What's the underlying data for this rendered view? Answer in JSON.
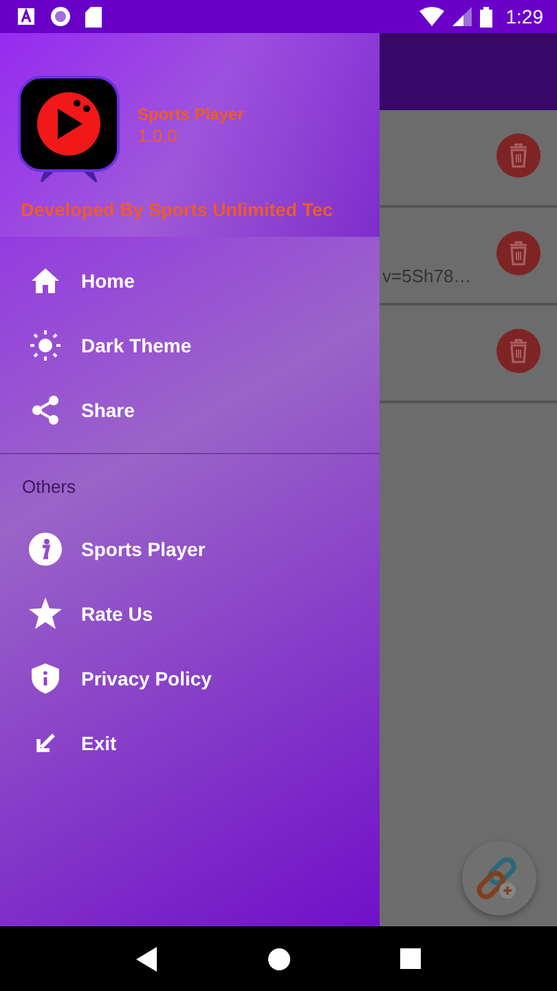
{
  "status_bar": {
    "time": "1:29"
  },
  "background": {
    "rows": [
      {
        "kind": "blank"
      },
      {
        "kind": "text",
        "text": "v=5Sh78…"
      },
      {
        "kind": "blank"
      }
    ]
  },
  "drawer": {
    "header": {
      "title": "Sports Player",
      "version": "1.0.0",
      "developer": "Developed By Sports Unlimited Tec"
    },
    "sections": [
      {
        "items": [
          {
            "kind": "home",
            "label": "Home"
          },
          {
            "kind": "sun",
            "label": "Dark Theme"
          },
          {
            "kind": "share",
            "label": "Share"
          }
        ]
      },
      {
        "title": "Others",
        "items": [
          {
            "kind": "info",
            "label": "Sports Player"
          },
          {
            "kind": "star",
            "label": "Rate Us"
          },
          {
            "kind": "shield",
            "label": "Privacy Policy"
          },
          {
            "kind": "exit",
            "label": "Exit"
          }
        ]
      }
    ]
  }
}
